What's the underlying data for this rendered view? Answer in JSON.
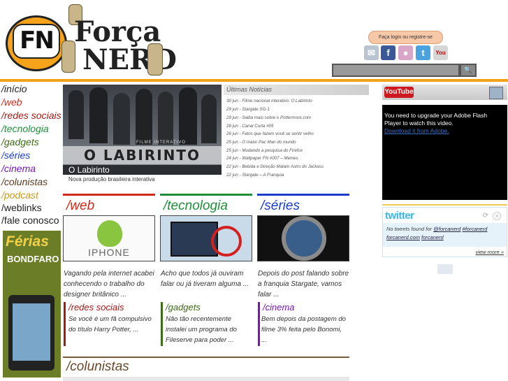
{
  "header": {
    "logo_fn": "FN",
    "logo_forca": "Força",
    "logo_nerd": "NERD",
    "login": "Faça login ou registre-se",
    "social": [
      {
        "name": "email",
        "glyph": "✉",
        "color": "#b9c4d2"
      },
      {
        "name": "facebook",
        "glyph": "f",
        "color": "#3b5998"
      },
      {
        "name": "flickr",
        "glyph": "●",
        "color": "#d9a6c8"
      },
      {
        "name": "twitter",
        "glyph": "t",
        "color": "#4aa3df"
      },
      {
        "name": "youtube",
        "glyph": "You",
        "color": "#d6d6d6"
      }
    ],
    "search_placeholder": "",
    "search_button_glyph": "🔍"
  },
  "nav": [
    {
      "label": "/início",
      "color": "#222222"
    },
    {
      "label": "/web",
      "color": "#d02a1a"
    },
    {
      "label": "/redes sociais",
      "color": "#a61a15"
    },
    {
      "label": "/tecnologia",
      "color": "#1f8f3a"
    },
    {
      "label": "/gadgets",
      "color": "#3d6b16"
    },
    {
      "label": "/séries",
      "color": "#1a3ecb"
    },
    {
      "label": "/cinema",
      "color": "#7a16b8"
    },
    {
      "label": "/colunistas",
      "color": "#5a3a1e"
    },
    {
      "label": "/podcast",
      "color": "#c79a1c"
    },
    {
      "label": "/weblinks",
      "color": "#222222"
    },
    {
      "label": "/fale conosco",
      "color": "#222222"
    }
  ],
  "banner": {
    "title": "Férias",
    "brand": "BONDFARO"
  },
  "feature": {
    "image_overlay_label": "FILME INTERATIVO",
    "image_overlay_title": "O LABIRINTO",
    "title": "O Labirinto",
    "description": "Nova produção brasileira interativa"
  },
  "news": {
    "heading": "Últimas Notícias",
    "items": [
      "30 jun - Filme nacional interativo: O Labirinto",
      "29 jun - Stargate SG-1",
      "29 jun - Saiba mais sobre o Pottermore.com",
      "28 jun - Canal Curta #05",
      "26 jun - Fatos que fazem você se sentir velho",
      "25 jun - O maior Pac Man do mundo",
      "25 jun - Mudando a pesquisa do Firefox",
      "24 jun - Wallpaper FN #007 – Memes",
      "22 jun - Bebida e Direção Matam Astro do Jackass",
      "22 jun - Stargate – A Franquia"
    ]
  },
  "sections": [
    {
      "title": "/web",
      "color": "#d02a1a",
      "thumb_text": "IPHONE",
      "text": "Vagando pela internet acabei conhecendo o trabalho do designer britânico ..."
    },
    {
      "title": "/tecnologia",
      "color": "#1f8f3a",
      "thumb_text": "",
      "text": "Acho que todos já ouviram falar ou já tiveram alguma ..."
    },
    {
      "title": "/séries",
      "color": "#1a3ecb",
      "thumb_text": "",
      "text": "Depois do post falando sobre a franquia Stargate, vamos falar ..."
    }
  ],
  "subsections": [
    {
      "title": "/redes sociais",
      "color": "#a61a15",
      "text": "Se você é um fã compulsivo do título Harry Potter, ..."
    },
    {
      "title": "/gadgets",
      "color": "#3d6b16",
      "text": "Não tão recentemente instalei um programa do Fileserve para poder ..."
    },
    {
      "title": "/cinema",
      "color": "#7a16b8",
      "text": "Bem depois da postagem do filme 3% feita pelo Bonomi, ..."
    }
  ],
  "colunistas": {
    "title": "/colunistas"
  },
  "youtube": {
    "logo": "YouTube",
    "message": "You need to upgrade your Adobe Flash Player to watch this video.",
    "link": "Download it from Adobe."
  },
  "twitter": {
    "logo": "twitter",
    "body_prefix": "No tweets found for ",
    "handle": "@forcanerd",
    "tag1": "#forcanerd",
    "site": "forcanerd.com",
    "tag2": "forcanerd",
    "more": "view more »"
  }
}
